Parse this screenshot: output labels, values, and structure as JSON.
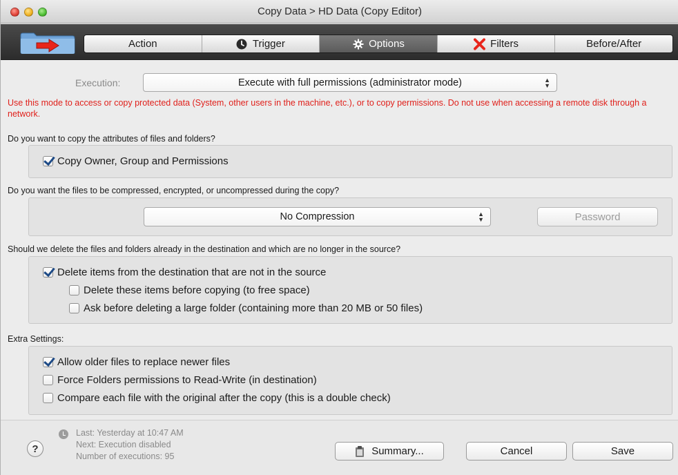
{
  "window": {
    "title": "Copy Data > HD Data (Copy Editor)"
  },
  "toolbar": {
    "tabs": [
      {
        "label": "Action",
        "icon": "none",
        "active": false
      },
      {
        "label": "Trigger",
        "icon": "clock-icon",
        "active": false
      },
      {
        "label": "Options",
        "icon": "gear-icon",
        "active": true
      },
      {
        "label": "Filters",
        "icon": "x-mark-icon",
        "active": false
      },
      {
        "label": "Before/After",
        "icon": "none",
        "active": false
      }
    ],
    "accent_red": "#e8251b"
  },
  "execution": {
    "label": "Execution:",
    "value": "Execute with full permissions (administrator mode)",
    "warning": "Use this mode to access or copy protected data (System, other users in the machine, etc.), or to copy permissions. Do not use when accessing a remote disk through a network."
  },
  "attributes": {
    "question": "Do you want to copy the attributes of files and folders?",
    "copy_owner": {
      "label": "Copy Owner, Group and Permissions",
      "checked": true
    }
  },
  "compression": {
    "question": "Do you want the files to be compressed, encrypted, or uncompressed during the copy?",
    "value": "No Compression",
    "password_button": "Password"
  },
  "deletion": {
    "question": "Should we delete the files and folders already in the destination and which are no longer in the source?",
    "delete_items": {
      "label": "Delete items from the destination that are not in the source",
      "checked": true
    },
    "delete_before": {
      "label": "Delete these items before copying (to free space)",
      "checked": false
    },
    "ask_before": {
      "label": "Ask before deleting a large folder (containing more than 20 MB or 50 files)",
      "checked": false
    }
  },
  "extra": {
    "heading": "Extra Settings:",
    "allow_older": {
      "label": "Allow older files to replace newer files",
      "checked": true
    },
    "force_folders": {
      "label": "Force Folders permissions to Read-Write (in destination)",
      "checked": false
    },
    "compare_files": {
      "label": "Compare each file with the original after the copy (this is a double check)",
      "checked": false
    }
  },
  "footer": {
    "last_run": "Last: Yesterday at 10:47 AM",
    "next_run": "Next: Execution disabled",
    "executions": "Number of executions: 95",
    "summary_button": "Summary...",
    "cancel_button": "Cancel",
    "save_button": "Save"
  }
}
